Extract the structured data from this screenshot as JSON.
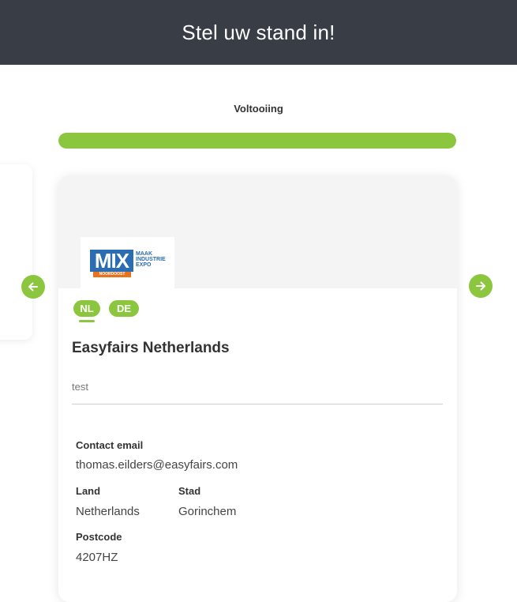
{
  "header": {
    "title": "Stel uw stand in!"
  },
  "progress": {
    "label": "Voltooiing",
    "percent": 100,
    "color": "#8cc63f"
  },
  "logo": {
    "mix": "MIX",
    "lines": [
      "MAAK",
      "INDUSTRIE",
      "EXPO"
    ],
    "sub": "NOORDOOST"
  },
  "languages": [
    "NL",
    "DE"
  ],
  "active_language": "NL",
  "company": {
    "name": "Easyfairs Netherlands",
    "description": "test"
  },
  "contact": {
    "email_label": "Contact email",
    "email": "thomas.eilders@easyfairs.com",
    "country_label": "Land",
    "country": "Netherlands",
    "city_label": "Stad",
    "city": "Gorinchem",
    "postcode_label": "Postcode",
    "postcode": "4207HZ"
  },
  "nav": {
    "prev_icon": "arrow-left-icon",
    "next_icon": "arrow-right-icon"
  }
}
